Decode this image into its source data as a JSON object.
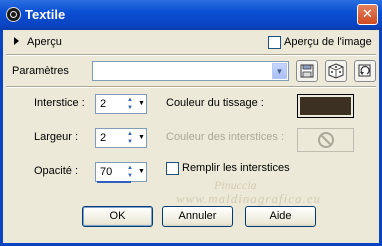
{
  "window": {
    "title": "Textile",
    "close_symbol": "✕"
  },
  "preview": {
    "label": "Aperçu",
    "image_preview_label": "Aperçu de l'image",
    "image_preview_checked": false
  },
  "presets": {
    "label": "Paramètres",
    "value": ""
  },
  "settings": {
    "interstice_label": "Interstice :",
    "interstice_value": "2",
    "largeur_label": "Largeur :",
    "largeur_value": "2",
    "opacite_label": "Opacité :",
    "opacite_value": "70",
    "couleur_tissage_label": "Couleur du tissage :",
    "couleur_tissage_color": "#3b3022",
    "couleur_interstices_label": "Couleur des interstices :",
    "remplir_label": "Remplir les interstices",
    "remplir_checked": false
  },
  "buttons": {
    "ok": "OK",
    "annuler": "Annuler",
    "aide": "Aide"
  },
  "watermark": {
    "line1": "Pinuccia",
    "line2": "www.maldinagrafica.eu"
  }
}
